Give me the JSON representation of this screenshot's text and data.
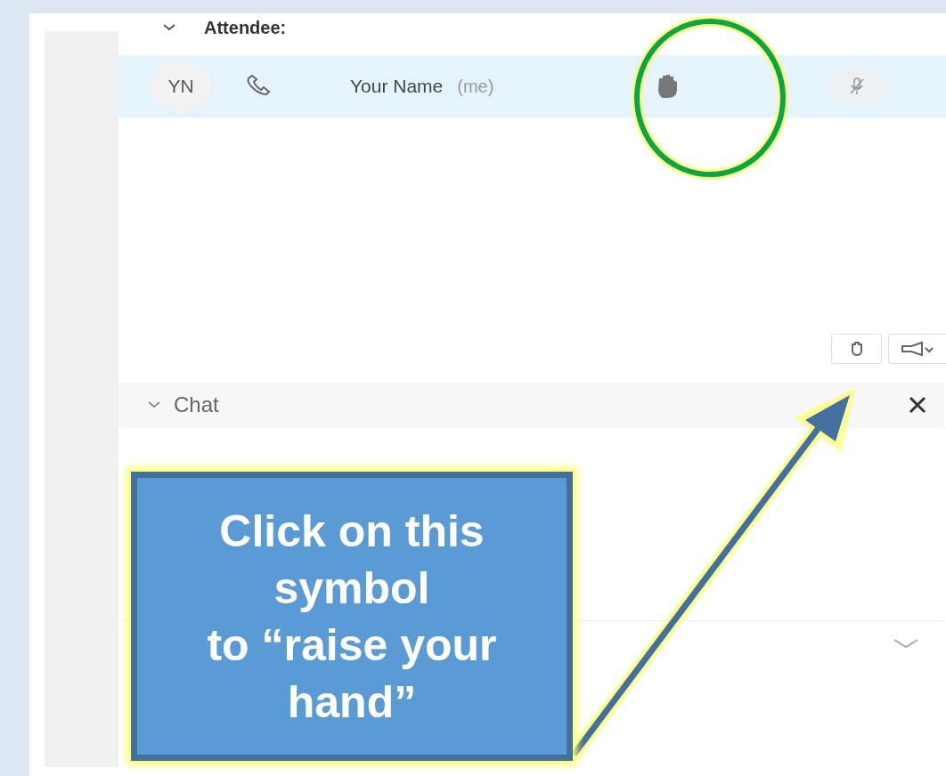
{
  "attendee_section": {
    "label": "Attendee:",
    "expanded": true
  },
  "participants": [
    {
      "initials": "YN",
      "name": "Your Name",
      "suffix": "(me)",
      "selected": true
    }
  ],
  "chat": {
    "label": "Chat",
    "expanded": true
  },
  "callout": {
    "lines": [
      "Click on this",
      "symbol",
      "to “raise your",
      "hand”"
    ]
  }
}
